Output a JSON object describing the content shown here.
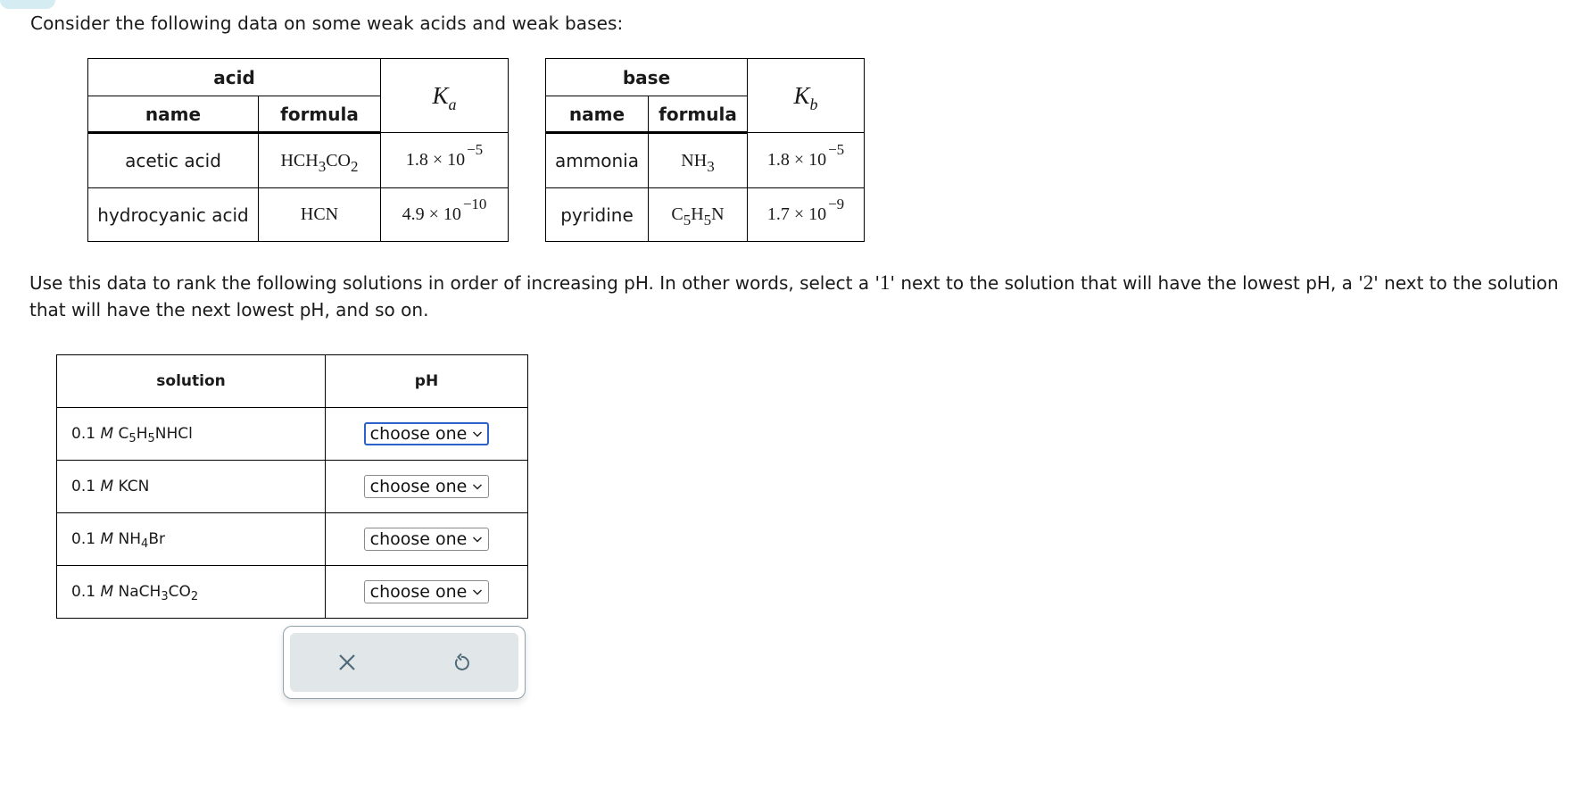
{
  "intro": "Consider the following data on some weak acids and weak bases:",
  "acid_table": {
    "group_header": "acid",
    "col_name": "name",
    "col_formula": "formula",
    "k_symbol": "K",
    "k_subscript": "a",
    "rows": [
      {
        "name": "acetic acid",
        "formula_parts": [
          "HCH",
          "3",
          "CO",
          "2"
        ],
        "k_mantissa": "1.8 × 10",
        "k_exponent": "−5"
      },
      {
        "name": "hydrocyanic acid",
        "formula_parts": [
          "HCN"
        ],
        "k_mantissa": "4.9 × 10",
        "k_exponent": "−10"
      }
    ]
  },
  "base_table": {
    "group_header": "base",
    "col_name": "name",
    "col_formula": "formula",
    "k_symbol": "K",
    "k_subscript": "b",
    "rows": [
      {
        "name": "ammonia",
        "formula_parts": [
          "NH",
          "3"
        ],
        "k_mantissa": "1.8 × 10",
        "k_exponent": "−5"
      },
      {
        "name": "pyridine",
        "formula_parts": [
          "C",
          "5",
          "H",
          "5",
          "N"
        ],
        "k_mantissa": "1.7 × 10",
        "k_exponent": "−9"
      }
    ]
  },
  "instructions": {
    "part1": "Use this data to rank the following solutions in order of increasing pH. In other words, select a '",
    "one": "1",
    "part2": "' next to the solution that will have the lowest pH, a '",
    "two": "2",
    "part3": "' next to the solution that will have the next lowest pH, and so on."
  },
  "solution_table": {
    "col_solution": "solution",
    "col_ph": "pH",
    "rows": [
      {
        "conc": "0.1",
        "unit": "M",
        "formula_parts": [
          "C",
          "5",
          "H",
          "5",
          "NHCl"
        ],
        "select_value": "choose one",
        "focused": true
      },
      {
        "conc": "0.1",
        "unit": "M",
        "formula_parts": [
          "KCN"
        ],
        "select_value": "choose one",
        "focused": false
      },
      {
        "conc": "0.1",
        "unit": "M",
        "formula_parts": [
          "NH",
          "4",
          "Br"
        ],
        "select_value": "choose one",
        "focused": false
      },
      {
        "conc": "0.1",
        "unit": "M",
        "formula_parts": [
          "NaCH",
          "3",
          "CO",
          "2"
        ],
        "select_value": "choose one",
        "focused": false
      }
    ]
  },
  "actions": {
    "clear_icon": "x-icon",
    "reset_icon": "undo-icon"
  },
  "colors": {
    "focus_border": "#2b63c9",
    "action_bg": "#e1e6e9",
    "icon": "#4f6a78",
    "corner_tab": "#d6ecf3"
  }
}
